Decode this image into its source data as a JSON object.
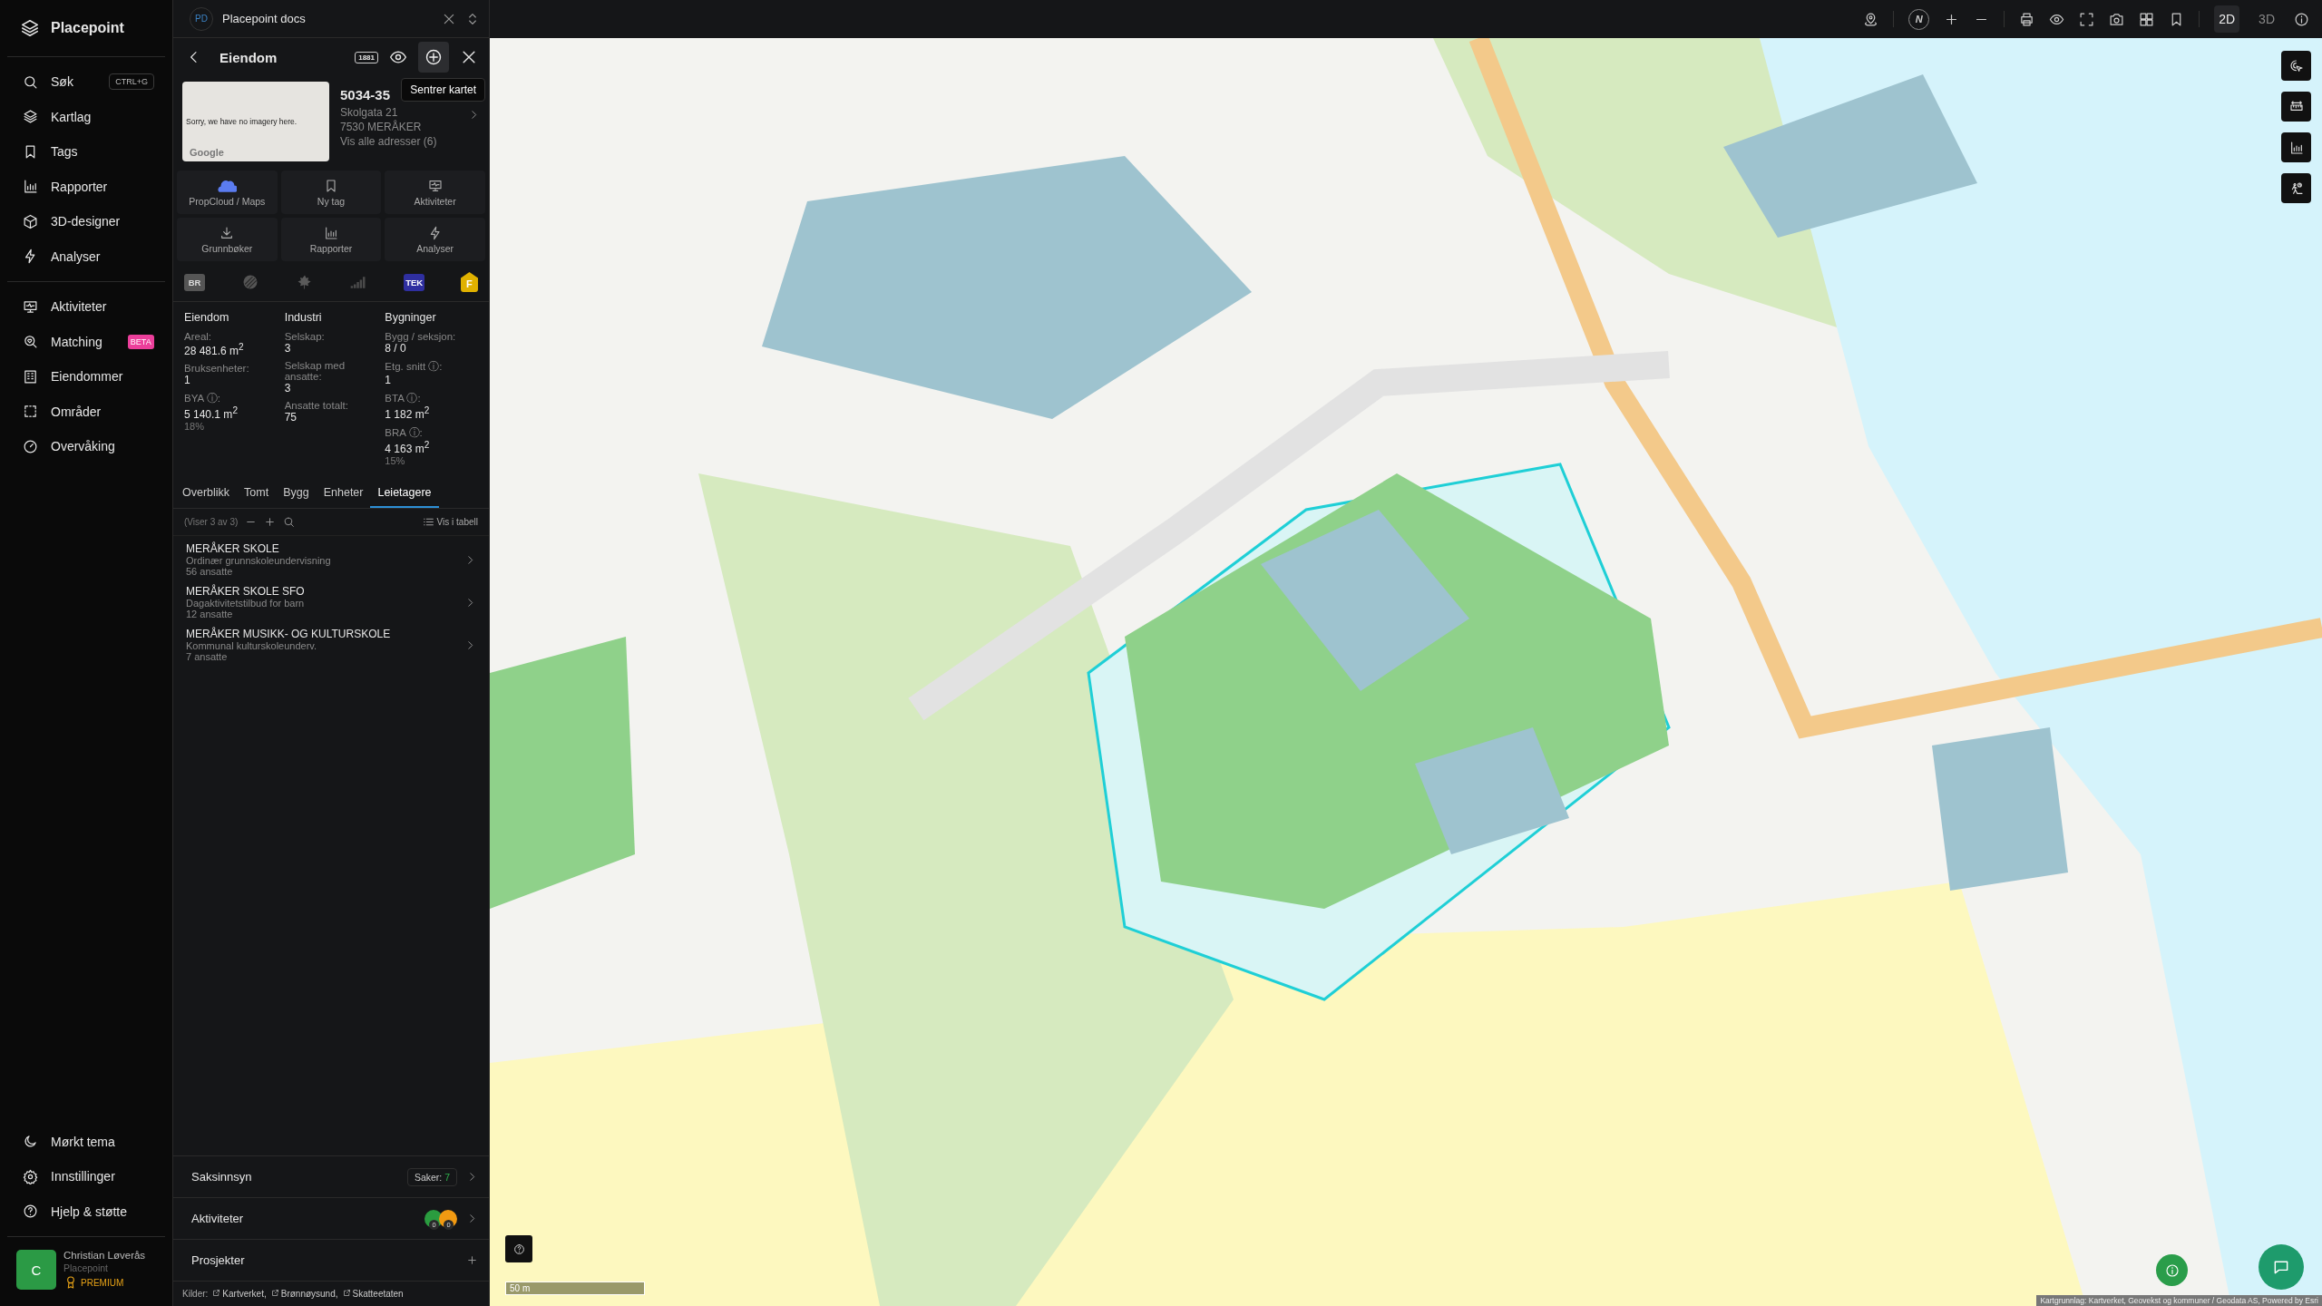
{
  "app": {
    "name": "Placepoint"
  },
  "nav_main": [
    {
      "label": "Søk",
      "shortcut": "CTRL+G"
    },
    {
      "label": "Kartlag"
    },
    {
      "label": "Tags"
    },
    {
      "label": "Rapporter"
    },
    {
      "label": "3D-designer"
    },
    {
      "label": "Analyser"
    }
  ],
  "nav_tools": [
    {
      "label": "Aktiviteter"
    },
    {
      "label": "Matching",
      "badge": "BETA"
    },
    {
      "label": "Eiendommer"
    },
    {
      "label": "Områder"
    },
    {
      "label": "Overvåking"
    }
  ],
  "nav_bottom": [
    {
      "label": "Mørkt tema"
    },
    {
      "label": "Innstillinger"
    },
    {
      "label": "Hjelp & støtte"
    }
  ],
  "user": {
    "initial": "C",
    "name": "Christian Løverås",
    "org": "Placepoint",
    "plan": "PREMIUM"
  },
  "panel": {
    "workspace": {
      "initials": "PD",
      "name": "Placepoint docs"
    },
    "title": "Eiendom",
    "badge": "1881",
    "tooltip": "Sentrer kartet",
    "property": {
      "image_text": "Sorry, we have no imagery here.",
      "image_credit": "Google",
      "id": "5034-35",
      "address": "Skolgata 21",
      "postal": "7530 MERÅKER",
      "all_addresses": "Vis alle adresser (6)"
    },
    "actions": [
      "PropCloud / Maps",
      "Ny tag",
      "Aktiviteter",
      "Grunnbøker",
      "Rapporter",
      "Analyser"
    ],
    "register_badges": {
      "br": "BR",
      "tek": "TEK",
      "energy": "F"
    },
    "stats": [
      {
        "heading": "Eiendom",
        "fields": [
          {
            "label": "Areal:",
            "value": "28 481.6 m$^{2}$"
          },
          {
            "label": "Bruksenheter:",
            "value": "1"
          },
          {
            "label": "BYA ⓘ:",
            "value": "5 140.1 m$^{2}$",
            "share": "18%"
          }
        ]
      },
      {
        "heading": "Industri",
        "fields": [
          {
            "label": "Selskap:",
            "value": "3"
          },
          {
            "label": "Selskap med ansatte:",
            "value": "3"
          },
          {
            "label": "Ansatte totalt:",
            "value": "75"
          }
        ]
      },
      {
        "heading": "Bygninger",
        "fields": [
          {
            "label": "Bygg / seksjon:",
            "value": "8 / 0"
          },
          {
            "label": "Etg. snitt ⓘ:",
            "value": "1"
          },
          {
            "label": "BTA ⓘ:",
            "value": "1 182 m$^{2}$"
          },
          {
            "label": "BRA ⓘ:",
            "value": "4 163 m$^{2}$",
            "share": "15%"
          }
        ]
      }
    ],
    "tabs": [
      {
        "label": "Overblikk",
        "selected": false
      },
      {
        "label": "Tomt",
        "selected": false
      },
      {
        "label": "Bygg",
        "selected": false
      },
      {
        "label": "Enheter",
        "selected": false
      },
      {
        "label": "Leietagere",
        "selected": true
      }
    ],
    "list_toolbar": {
      "count": "(Viser 3 av 3)",
      "table_link": "Vis i tabell"
    },
    "tenants": [
      {
        "name": "MERÅKER SKOLE",
        "description": "Ordinær grunnskoleundervisning",
        "employees": "56 ansatte"
      },
      {
        "name": "MERÅKER SKOLE SFO",
        "description": "Dagaktivitetstilbud for barn",
        "employees": "12 ansatte"
      },
      {
        "name": "MERÅKER MUSIKK- OG KULTURSKOLE",
        "description": "Kommunal kulturskoleunderv.",
        "employees": "7 ansatte"
      }
    ],
    "sections": [
      {
        "kind": "cases",
        "label": "Saksinnsyn",
        "count_label": "Saker:",
        "count": "7"
      },
      {
        "kind": "activities",
        "label": "Aktiviteter",
        "counts": [
          "0",
          "0"
        ]
      },
      {
        "kind": "projects",
        "label": "Prosjekter"
      }
    ],
    "sources": {
      "label": "Kilder:",
      "links": [
        "Kartverket,",
        "Brønnøysund,",
        "Skatteetaten"
      ]
    }
  },
  "map": {
    "compass": "N",
    "modes": [
      {
        "label": "2D",
        "selected": true
      },
      {
        "label": "3D",
        "selected": false
      }
    ],
    "scale": "50 m",
    "attribution": "Kartgrunnlag: Kartverket, Geovekst og kommuner / Geodata AS, Powered by Esri"
  }
}
